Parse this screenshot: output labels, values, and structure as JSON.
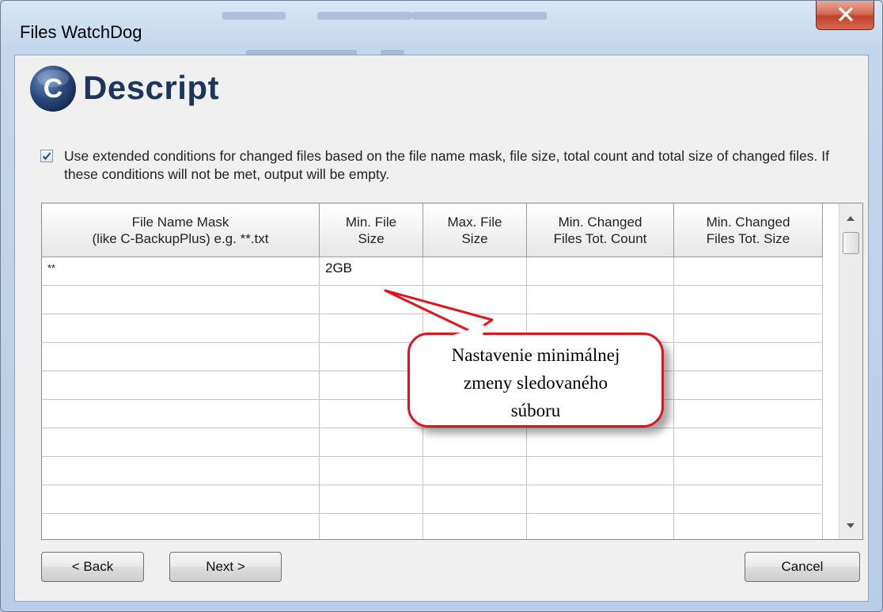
{
  "window": {
    "title": "Files WatchDog"
  },
  "header": {
    "logo_letter": "C",
    "logo_text": "Descript"
  },
  "extended_conditions": {
    "checked": true,
    "label": "Use extended conditions for changed files based on the file name mask, file size, total count and total size of changed files. If these conditions will not be met, output will be empty."
  },
  "grid": {
    "columns": [
      {
        "line1": "File Name Mask",
        "line2": "(like C-BackupPlus) e.g. **.txt"
      },
      {
        "line1": "Min. File",
        "line2": "Size"
      },
      {
        "line1": "Max. File",
        "line2": "Size"
      },
      {
        "line1": "Min. Changed",
        "line2": "Files Tot. Count"
      },
      {
        "line1": "Min. Changed",
        "line2": "Files Tot. Size"
      }
    ],
    "rows": [
      [
        "**",
        "2GB",
        "",
        "",
        ""
      ],
      [
        "",
        "",
        "",
        "",
        ""
      ],
      [
        "",
        "",
        "",
        "",
        ""
      ],
      [
        "",
        "",
        "",
        "",
        ""
      ],
      [
        "",
        "",
        "",
        "",
        ""
      ],
      [
        "",
        "",
        "",
        "",
        ""
      ],
      [
        "",
        "",
        "",
        "",
        ""
      ],
      [
        "",
        "",
        "",
        "",
        ""
      ],
      [
        "",
        "",
        "",
        "",
        ""
      ],
      [
        "",
        "",
        "",
        "",
        ""
      ]
    ]
  },
  "callout": {
    "line1": "Nastavenie minimálnej",
    "line2": "zmeny sledovaného",
    "line3": "súboru"
  },
  "buttons": {
    "back": "< Back",
    "next": "Next >",
    "cancel": "Cancel"
  },
  "colors": {
    "accent": "#1e3559",
    "callout_border": "#e0141e",
    "close_button": "#c1412c"
  }
}
